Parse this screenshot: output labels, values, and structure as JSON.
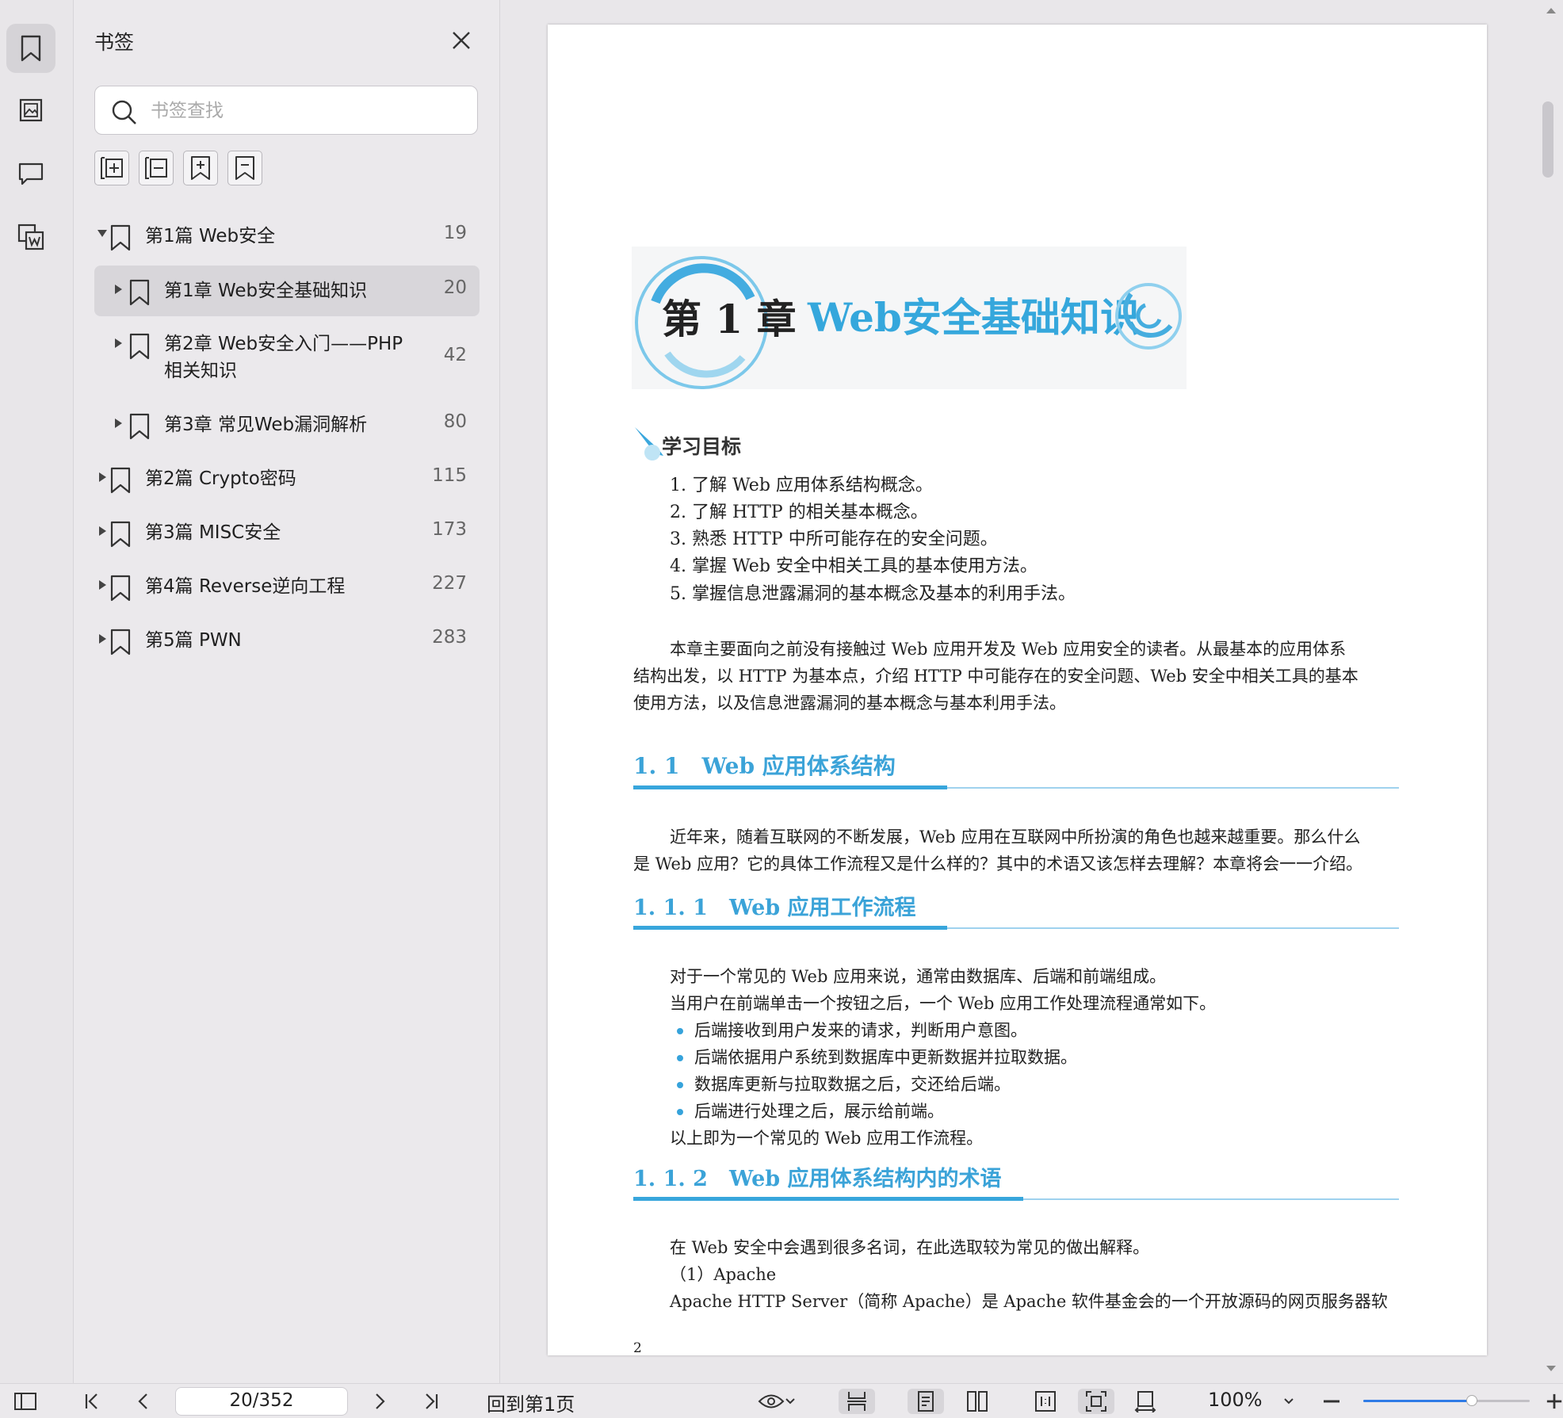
{
  "sidebar_rail": {
    "icons": [
      "bookmark-icon",
      "image-icon",
      "comment-icon",
      "word-convert-icon"
    ]
  },
  "bookmarks_panel": {
    "title": "书签",
    "search_placeholder": "书签查找",
    "tools": [
      "add-bookmark-icon",
      "remove-bookmark-icon",
      "insert-bookmark-icon",
      "bookmark-icon"
    ],
    "items": [
      {
        "label": "第1篇 Web安全",
        "page": "19",
        "expanded": true,
        "level": 0
      },
      {
        "label": "第1章 Web安全基础知识",
        "page": "20",
        "expanded": false,
        "level": 1,
        "selected": true
      },
      {
        "label_line1": "第2章 Web安全入门——PHP",
        "label_line2": "相关知识",
        "page": "42",
        "expanded": false,
        "level": 1
      },
      {
        "label": "第3章 常见Web漏洞解析",
        "page": "80",
        "expanded": false,
        "level": 1
      },
      {
        "label": "第2篇 Crypto密码",
        "page": "115",
        "expanded": false,
        "level": 0
      },
      {
        "label": "第3篇 MISC安全",
        "page": "173",
        "expanded": false,
        "level": 0
      },
      {
        "label": "第4篇 Reverse逆向工程",
        "page": "227",
        "expanded": false,
        "level": 0
      },
      {
        "label": "第5篇 PWN",
        "page": "283",
        "expanded": false,
        "level": 0
      }
    ]
  },
  "document": {
    "chapter_number": "第 1 章",
    "chapter_title": "Web安全基础知识",
    "objectives_heading": "学习目标",
    "objectives": [
      "1. 了解 Web 应用体系结构概念。",
      "2. 了解 HTTP 的相关基本概念。",
      "3. 熟悉 HTTP 中所可能存在的安全问题。",
      "4. 掌握 Web 安全中相关工具的基本使用方法。",
      "5. 掌握信息泄露漏洞的基本概念及基本的利用手法。"
    ],
    "intro_lines": [
      "本章主要面向之前没有接触过 Web 应用开发及 Web 应用安全的读者。从最基本的应用体系",
      "结构出发，以 HTTP 为基本点，介绍 HTTP 中可能存在的安全问题、Web 安全中相关工具的基本",
      "使用方法，以及信息泄露漏洞的基本概念与基本利用手法。"
    ],
    "section_1_1": "1. 1　Web 应用体系结构",
    "section_1_1_lines": [
      "近年来，随着互联网的不断发展，Web 应用在互联网中所扮演的角色也越来越重要。那么什么",
      "是 Web 应用？它的具体工作流程又是什么样的？其中的术语又该怎样去理解？本章将会一一介绍。"
    ],
    "section_1_1_1": "1. 1. 1　Web 应用工作流程",
    "section_1_1_1_lines": [
      "对于一个常见的 Web 应用来说，通常由数据库、后端和前端组成。",
      "当用户在前端单击一个按钮之后，一个 Web 应用工作处理流程通常如下。"
    ],
    "workflow_bullets": [
      "后端接收到用户发来的请求，判断用户意图。",
      "后端依据用户系统到数据库中更新数据并拉取数据。",
      "数据库更新与拉取数据之后，交还给后端。",
      "后端进行处理之后，展示给前端。"
    ],
    "workflow_end": "以上即为一个常见的 Web 应用工作流程。",
    "section_1_1_2": "1. 1. 2　Web 应用体系结构内的术语",
    "section_1_1_2_lines": [
      "在 Web 安全中会遇到很多名词，在此选取较为常见的做出解释。",
      "（1）Apache",
      "Apache HTTP Server（简称 Apache）是 Apache 软件基金会的一个开放源码的网页服务器软"
    ],
    "page_number": "2"
  },
  "status_bar": {
    "page_indicator": "20/352",
    "back_to_first": "回到第1页",
    "zoom": "100%",
    "zoom_level_fraction": 0.65
  }
}
